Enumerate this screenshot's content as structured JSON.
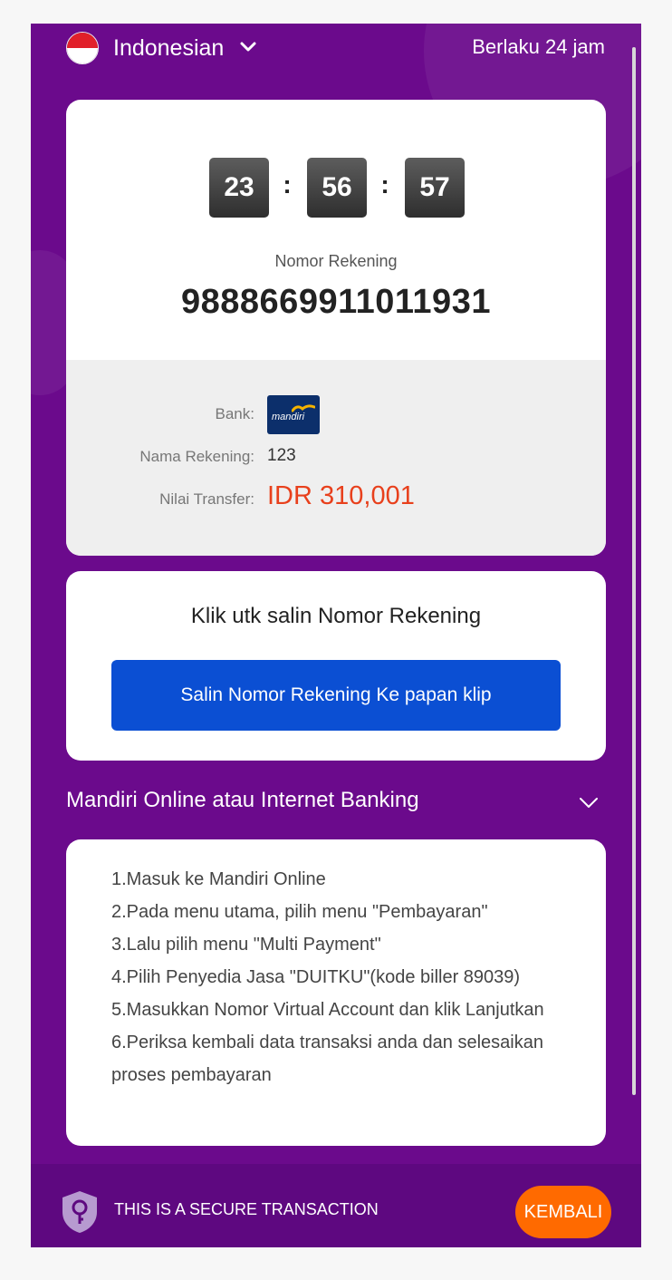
{
  "header": {
    "language": "Indonesian",
    "validity": "Berlaku 24 jam"
  },
  "timer": {
    "hours": "23",
    "minutes": "56",
    "seconds": "57",
    "separator": ":"
  },
  "account": {
    "label": "Nomor Rekening",
    "number": "9888669911011931"
  },
  "details": {
    "bank_label": "Bank:",
    "bank_logo_text": "mandiri",
    "name_label": "Nama Rekening:",
    "name_value": "123",
    "amount_label": "Nilai Transfer:",
    "amount_value": "IDR 310,001"
  },
  "copy": {
    "title": "Klik utk salin Nomor Rekening",
    "button": "Salin Nomor Rekening Ke papan klip"
  },
  "instructions": {
    "title": "Mandiri Online atau Internet Banking",
    "steps": [
      "1.Masuk ke Mandiri Online",
      "2.Pada menu utama, pilih menu \"Pembayaran\"",
      "3.Lalu pilih menu \"Multi Payment\"",
      "4.Pilih Penyedia Jasa \"DUITKU\"(kode biller 89039)",
      "5.Masukkan Nomor Virtual Account dan klik Lanjutkan",
      "6.Periksa kembali data transaksi anda dan selesaikan proses pembayaran"
    ]
  },
  "footer": {
    "secure_text": "THIS IS A SECURE TRANSACTION",
    "back_button": "KEMBALI"
  },
  "colors": {
    "background_purple": "#6b0a8c",
    "copy_button_blue": "#0b4fd3",
    "amount_orange": "#e8401c",
    "back_button_orange": "#ff6a00"
  },
  "icons": [
    "indonesia-flag-icon",
    "chevron-down-icon",
    "mandiri-logo",
    "shield-key-icon"
  ]
}
